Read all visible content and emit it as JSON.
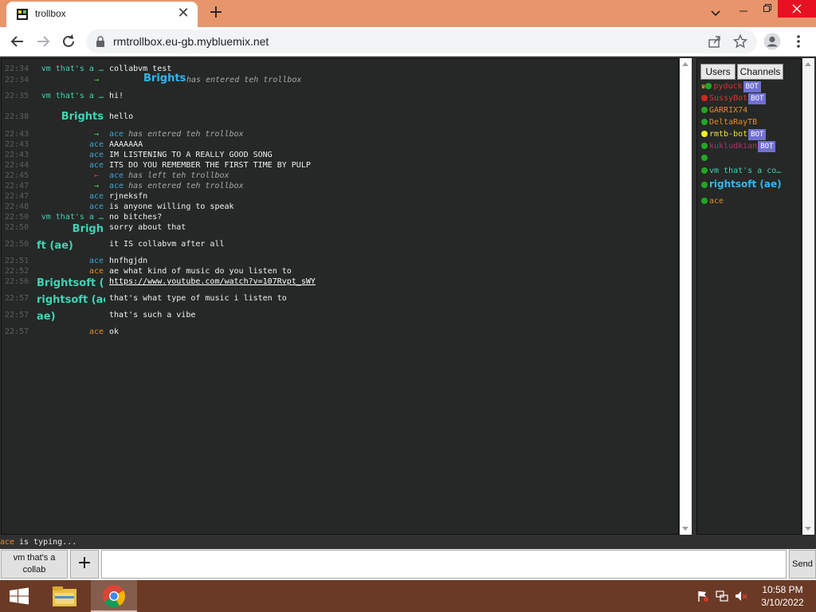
{
  "browser": {
    "tab_title": "trollbox",
    "url": "rmtrollbox.eu-gb.mybluemix.net",
    "new_tab_label": "+",
    "tab_close_label": "✕"
  },
  "chat": {
    "messages": [
      {
        "time": "22:34",
        "nick": "vm that's a …",
        "text": "collabvm test"
      },
      {
        "time": "22:34",
        "arrow": "→",
        "fancy_nick": "Brights",
        "system": "has entered teh trollbox"
      },
      {
        "time": "22:35",
        "nick": "vm that's a …",
        "text": "hi!"
      },
      {
        "time": "22:38",
        "fancy_nick": "Brights",
        "text": "hello"
      },
      {
        "time": "22:43",
        "arrow": "→",
        "who": "ace",
        "system": "has entered teh trollbox"
      },
      {
        "time": "22:43",
        "nick": "ace",
        "text": "AAAAAAA"
      },
      {
        "time": "22:43",
        "nick": "ace",
        "text": "IM LISTENING TO A REALLY GOOD SONG"
      },
      {
        "time": "22:44",
        "nick": "ace",
        "text": "ITS DO YOU REMEMBER THE FIRST TIME BY PULP"
      },
      {
        "time": "22:45",
        "arrow": "←",
        "who": "ace",
        "system": "has left teh trollbox"
      },
      {
        "time": "22:47",
        "arrow": "→",
        "who": "ace",
        "system": "has entered teh trollbox"
      },
      {
        "time": "22:47",
        "nick": "ace",
        "text": "rjneksfn"
      },
      {
        "time": "22:48",
        "nick": "ace",
        "text": "is anyone willing to speak"
      },
      {
        "time": "22:50",
        "nick": "vm that's a …",
        "text": "no bitches?"
      },
      {
        "time": "22:50",
        "fancy_nick": "Brigh",
        "text": "sorry about that"
      },
      {
        "time": "22:50",
        "fancy_nick": "ft (ae)",
        "text": "it IS collabvm after all"
      },
      {
        "time": "22:51",
        "nick": "ace",
        "text": "hnfhgjdn"
      },
      {
        "time": "22:52",
        "nick": "ace",
        "text": "ae what kind of music do you listen to"
      },
      {
        "time": "22:56",
        "fancy_nick": "Brightsoft (",
        "link": "https://www.youtube.com/watch?v=107Rvpt_sWY"
      },
      {
        "time": "22:57",
        "fancy_nick": "rightsoft (ae",
        "text": "that's what type of music i listen to"
      },
      {
        "time": "22:57",
        "fancy_nick": "ae)",
        "text": "that's such a vibe"
      },
      {
        "time": "22:57",
        "nick": "ace",
        "text": "ok"
      }
    ],
    "typing_nick": "ace",
    "typing_text": "is typing..."
  },
  "users": {
    "tab_users": "Users",
    "tab_channels": "Channels",
    "list": [
      {
        "name": "pyduck",
        "color": "#e03030",
        "dot": "#22a822",
        "bot": "BOT",
        "crown": true
      },
      {
        "name": "SussyBot",
        "color": "#e03030",
        "dot": "#e02020",
        "bot": "BOT"
      },
      {
        "name": "GARRIX74",
        "color": "#e38b2b",
        "dot": "#22a822"
      },
      {
        "name": "DeltaRayTB",
        "color": "#e38b2b",
        "dot": "#22a822"
      },
      {
        "name": "rmtb-bot",
        "color": "#f0e040",
        "dot": "#f0f020",
        "bot": "BOT"
      },
      {
        "name": "kukludkian",
        "color": "#b0306a",
        "dot": "#22a822",
        "bot": "BOT"
      },
      {
        "name": "",
        "color": "#3fd3b6",
        "dot": "#22a822"
      },
      {
        "name": "vm that's a co…",
        "color": "#3fd3b6",
        "dot": "#22a822"
      },
      {
        "name": "rightsoft (ae)",
        "color": "#33b5f0",
        "dot": "#22a822",
        "fancy": true
      },
      {
        "name": "ace",
        "color": "#e38b2b",
        "dot": "#22a822"
      }
    ]
  },
  "composer": {
    "channel_label": "vm that's a collab",
    "plus_label": "+",
    "send_label": "Send",
    "input_value": ""
  },
  "taskbar": {
    "time": "10:58 PM",
    "date": "3/10/2022"
  }
}
